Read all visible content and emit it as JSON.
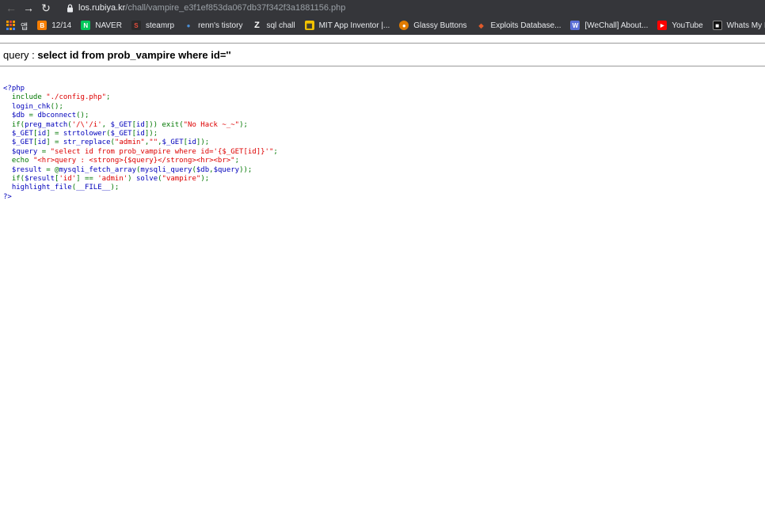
{
  "browser": {
    "url_host": "los.rubiya.kr",
    "url_path": "/chall/vampire_e3f1ef853da067db37f342f3a1881156.php"
  },
  "bookmarks": [
    {
      "label": "앱",
      "icon": "apps-grid-icon",
      "color": "#f29900"
    },
    {
      "label": "12/14",
      "icon": "blogger-icon",
      "color": "#f57d00"
    },
    {
      "label": "NAVER",
      "icon": "naver-icon",
      "color": "#03c75a"
    },
    {
      "label": "steamrp",
      "icon": "steamrp-icon",
      "color": "#c0392b"
    },
    {
      "label": "renn's tistory",
      "icon": "tistory-icon",
      "color": "#4a90d9"
    },
    {
      "label": "sql chall",
      "icon": "z-icon",
      "color": "#ffffff"
    },
    {
      "label": "MIT App Inventor |...",
      "icon": "app-inventor-icon",
      "color": "#f2c200"
    },
    {
      "label": "Glassy Buttons",
      "icon": "glassy-icon",
      "color": "#e07b00"
    },
    {
      "label": "Exploits Database...",
      "icon": "exploit-db-icon",
      "color": "#e05a2b"
    },
    {
      "label": "[WeChall] About...",
      "icon": "wechall-icon",
      "color": "#5b6fd6"
    },
    {
      "label": "YouTube",
      "icon": "youtube-icon",
      "color": "#ff0000"
    },
    {
      "label": "Whats My IP A",
      "icon": "whatsmyip-icon",
      "color": "#222222"
    }
  ],
  "page": {
    "query_prefix": "query : ",
    "query_value": "select id from prob_vampire where id=''"
  },
  "code_lines": [
    [
      {
        "t": "<?php",
        "c": "php"
      }
    ],
    [
      {
        "t": "  include ",
        "c": "kw"
      },
      {
        "t": "\"./config.php\"",
        "c": "str"
      },
      {
        "t": ";",
        "c": "kw"
      }
    ],
    [
      {
        "t": "  login_chk",
        "c": "php"
      },
      {
        "t": "();",
        "c": "kw"
      }
    ],
    [
      {
        "t": "  $db ",
        "c": "php"
      },
      {
        "t": "= ",
        "c": "kw"
      },
      {
        "t": "dbconnect",
        "c": "php"
      },
      {
        "t": "();",
        "c": "kw"
      }
    ],
    [
      {
        "t": "  if(",
        "c": "kw"
      },
      {
        "t": "preg_match",
        "c": "php"
      },
      {
        "t": "(",
        "c": "kw"
      },
      {
        "t": "'/\\'/i'",
        "c": "str"
      },
      {
        "t": ", ",
        "c": "kw"
      },
      {
        "t": "$_GET",
        "c": "php"
      },
      {
        "t": "[",
        "c": "kw"
      },
      {
        "t": "id",
        "c": "php"
      },
      {
        "t": "])) exit(",
        "c": "kw"
      },
      {
        "t": "\"No Hack ~_~\"",
        "c": "str"
      },
      {
        "t": ");",
        "c": "kw"
      }
    ],
    [
      {
        "t": "  $_GET",
        "c": "php"
      },
      {
        "t": "[",
        "c": "kw"
      },
      {
        "t": "id",
        "c": "php"
      },
      {
        "t": "] = ",
        "c": "kw"
      },
      {
        "t": "strtolower",
        "c": "php"
      },
      {
        "t": "(",
        "c": "kw"
      },
      {
        "t": "$_GET",
        "c": "php"
      },
      {
        "t": "[",
        "c": "kw"
      },
      {
        "t": "id",
        "c": "php"
      },
      {
        "t": "]);",
        "c": "kw"
      }
    ],
    [
      {
        "t": "  $_GET",
        "c": "php"
      },
      {
        "t": "[",
        "c": "kw"
      },
      {
        "t": "id",
        "c": "php"
      },
      {
        "t": "] = ",
        "c": "kw"
      },
      {
        "t": "str_replace",
        "c": "php"
      },
      {
        "t": "(",
        "c": "kw"
      },
      {
        "t": "\"admin\"",
        "c": "str"
      },
      {
        "t": ",",
        "c": "kw"
      },
      {
        "t": "\"\"",
        "c": "str"
      },
      {
        "t": ",",
        "c": "kw"
      },
      {
        "t": "$_GET",
        "c": "php"
      },
      {
        "t": "[",
        "c": "kw"
      },
      {
        "t": "id",
        "c": "php"
      },
      {
        "t": "]);",
        "c": "kw"
      }
    ],
    [
      {
        "t": "  $query ",
        "c": "php"
      },
      {
        "t": "= ",
        "c": "kw"
      },
      {
        "t": "\"select id from prob_vampire where id='{$_GET[id]}'\"",
        "c": "str"
      },
      {
        "t": ";",
        "c": "kw"
      }
    ],
    [
      {
        "t": "  echo ",
        "c": "kw"
      },
      {
        "t": "\"<hr>query : <strong>{$query}</strong><hr><br>\"",
        "c": "str"
      },
      {
        "t": ";",
        "c": "kw"
      }
    ],
    [
      {
        "t": "  $result ",
        "c": "php"
      },
      {
        "t": "= @",
        "c": "kw"
      },
      {
        "t": "mysqli_fetch_array",
        "c": "php"
      },
      {
        "t": "(",
        "c": "kw"
      },
      {
        "t": "mysqli_query",
        "c": "php"
      },
      {
        "t": "(",
        "c": "kw"
      },
      {
        "t": "$db",
        "c": "php"
      },
      {
        "t": ",",
        "c": "kw"
      },
      {
        "t": "$query",
        "c": "php"
      },
      {
        "t": "));",
        "c": "kw"
      }
    ],
    [
      {
        "t": "  if(",
        "c": "kw"
      },
      {
        "t": "$result",
        "c": "php"
      },
      {
        "t": "[",
        "c": "kw"
      },
      {
        "t": "'id'",
        "c": "str"
      },
      {
        "t": "] == ",
        "c": "kw"
      },
      {
        "t": "'admin'",
        "c": "str"
      },
      {
        "t": ") ",
        "c": "kw"
      },
      {
        "t": "solve",
        "c": "php"
      },
      {
        "t": "(",
        "c": "kw"
      },
      {
        "t": "\"vampire\"",
        "c": "str"
      },
      {
        "t": ");",
        "c": "kw"
      }
    ],
    [
      {
        "t": "  highlight_file",
        "c": "php"
      },
      {
        "t": "(",
        "c": "kw"
      },
      {
        "t": "__FILE__",
        "c": "php"
      },
      {
        "t": ");",
        "c": "kw"
      }
    ],
    [
      {
        "t": "?>",
        "c": "php"
      }
    ]
  ]
}
